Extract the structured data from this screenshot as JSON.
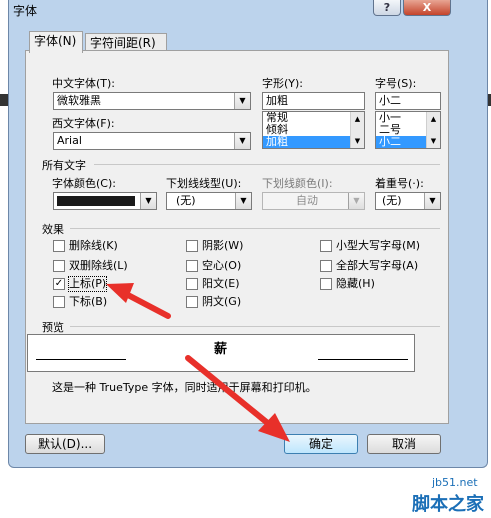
{
  "window": {
    "title": "字体",
    "help": "?",
    "close": "X"
  },
  "tabs": [
    {
      "label": "字体(N)"
    },
    {
      "label": "字符间距(R)"
    }
  ],
  "chinese_font": {
    "label": "中文字体(T):",
    "value": "微软雅黑"
  },
  "western_font": {
    "label": "西文字体(F):",
    "value": "Arial"
  },
  "style": {
    "label": "字形(Y):",
    "value": "加粗",
    "options": [
      "常规",
      "倾斜",
      "加粗"
    ],
    "selected": "加粗"
  },
  "size": {
    "label": "字号(S):",
    "value": "小二",
    "options": [
      "小一",
      "二号",
      "小二"
    ],
    "selected": "小二"
  },
  "all_text": {
    "section_label": "所有文字",
    "font_color_label": "字体颜色(C):",
    "font_color_value": "#1a1a1a",
    "underline_type_label": "下划线线型(U):",
    "underline_type_value": "(无)",
    "underline_color_label": "下划线颜色(I):",
    "underline_color_value": "自动",
    "emphasis_label": "着重号(·):",
    "emphasis_value": "(无)"
  },
  "effects": {
    "section_label": "效果",
    "items": [
      {
        "label": "删除线(K)",
        "checked": false
      },
      {
        "label": "双删除线(L)",
        "checked": false
      },
      {
        "label": "上标(P)",
        "checked": true
      },
      {
        "label": "下标(B)",
        "checked": false
      },
      {
        "label": "阴影(W)",
        "checked": false
      },
      {
        "label": "空心(O)",
        "checked": false
      },
      {
        "label": "阳文(E)",
        "checked": false
      },
      {
        "label": "阴文(G)",
        "checked": false
      },
      {
        "label": "小型大写字母(M)",
        "checked": false
      },
      {
        "label": "全部大写字母(A)",
        "checked": false
      },
      {
        "label": "隐藏(H)",
        "checked": false
      }
    ]
  },
  "preview": {
    "section_label": "预览",
    "sample": "薪",
    "note": "这是一种 TrueType 字体，同时适用于屏幕和打印机。"
  },
  "buttons": {
    "default": "默认(D)...",
    "ok": "确定",
    "cancel": "取消"
  },
  "annotation_color": "#e8302a",
  "watermark": {
    "domain": "jb51.net",
    "name": "脚本之家"
  }
}
